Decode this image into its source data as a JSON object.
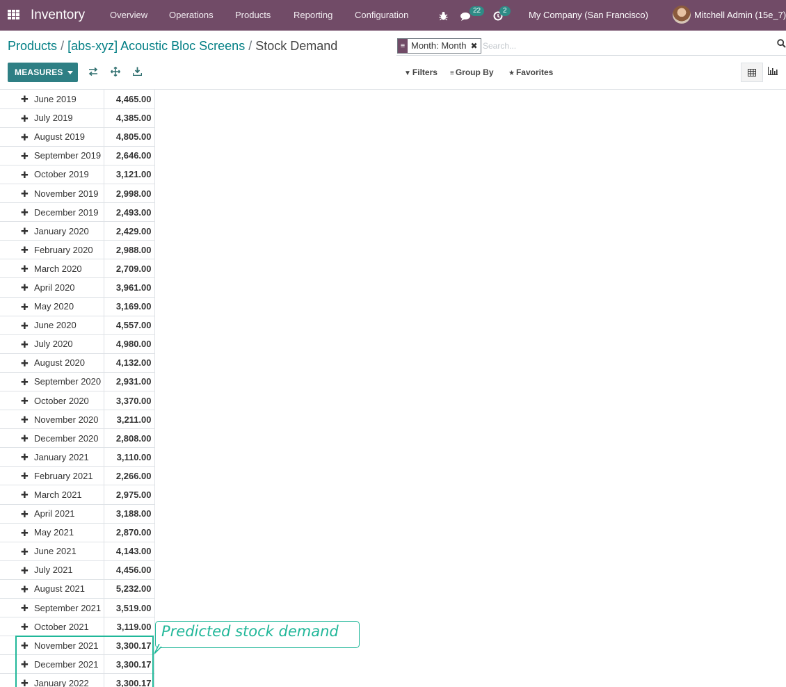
{
  "navbar": {
    "brand": "Inventory",
    "menu": [
      "Overview",
      "Operations",
      "Products",
      "Reporting",
      "Configuration"
    ],
    "messages_count": "22",
    "activities_count": "2",
    "company": "My Company (San Francisco)",
    "user": "Mitchell Admin (15e_7)"
  },
  "breadcrumb": {
    "root": "Products",
    "product": "[abs-xyz] Acoustic Bloc Screens",
    "current": "Stock Demand",
    "sep": "/"
  },
  "search": {
    "facet": "Month: Month",
    "placeholder": "Search..."
  },
  "toolbar": {
    "measures_label": "MEASURES",
    "filters_label": "Filters",
    "groupby_label": "Group By",
    "favorites_label": "Favorites"
  },
  "icons": {
    "apps": "apps-grid-icon",
    "bug": "bug-icon",
    "chat": "chat-icon",
    "activity": "clock-icon",
    "flip": "flip-axis-icon",
    "expand": "expand-all-icon",
    "download": "download-icon",
    "search": "search-icon",
    "pivot": "pivot-table-icon",
    "graph": "bar-chart-icon"
  },
  "colors": {
    "navbar": "#714b67",
    "primary": "#2e7f84",
    "link": "#017e84",
    "annotation": "#21b799"
  },
  "pivot_rows": [
    {
      "label": "June 2019",
      "value": "4,465.00"
    },
    {
      "label": "July 2019",
      "value": "4,385.00"
    },
    {
      "label": "August 2019",
      "value": "4,805.00"
    },
    {
      "label": "September 2019",
      "value": "2,646.00"
    },
    {
      "label": "October 2019",
      "value": "3,121.00"
    },
    {
      "label": "November 2019",
      "value": "2,998.00"
    },
    {
      "label": "December 2019",
      "value": "2,493.00"
    },
    {
      "label": "January 2020",
      "value": "2,429.00"
    },
    {
      "label": "February 2020",
      "value": "2,988.00"
    },
    {
      "label": "March 2020",
      "value": "2,709.00"
    },
    {
      "label": "April 2020",
      "value": "3,961.00"
    },
    {
      "label": "May 2020",
      "value": "3,169.00"
    },
    {
      "label": "June 2020",
      "value": "4,557.00"
    },
    {
      "label": "July 2020",
      "value": "4,980.00"
    },
    {
      "label": "August 2020",
      "value": "4,132.00"
    },
    {
      "label": "September 2020",
      "value": "2,931.00"
    },
    {
      "label": "October 2020",
      "value": "3,370.00"
    },
    {
      "label": "November 2020",
      "value": "3,211.00"
    },
    {
      "label": "December 2020",
      "value": "2,808.00"
    },
    {
      "label": "January 2021",
      "value": "3,110.00"
    },
    {
      "label": "February 2021",
      "value": "2,266.00"
    },
    {
      "label": "March 2021",
      "value": "2,975.00"
    },
    {
      "label": "April 2021",
      "value": "3,188.00"
    },
    {
      "label": "May 2021",
      "value": "2,870.00"
    },
    {
      "label": "June 2021",
      "value": "4,143.00"
    },
    {
      "label": "July 2021",
      "value": "4,456.00"
    },
    {
      "label": "August 2021",
      "value": "5,232.00"
    },
    {
      "label": "September 2021",
      "value": "3,519.00"
    },
    {
      "label": "October 2021",
      "value": "3,119.00"
    },
    {
      "label": "November 2021",
      "value": "3,300.17"
    },
    {
      "label": "December 2021",
      "value": "3,300.17"
    },
    {
      "label": "January 2022",
      "value": "3,300.17"
    }
  ],
  "annotation": {
    "text": "Predicted stock demand"
  }
}
